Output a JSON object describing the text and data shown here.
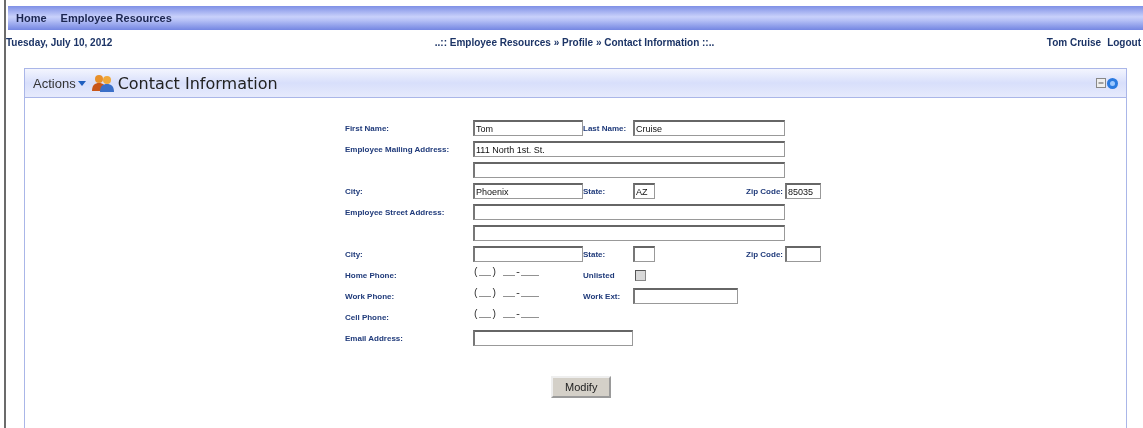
{
  "menu": [
    {
      "label": "Home"
    },
    {
      "label": "Employee Resources"
    }
  ],
  "info_bar": {
    "date": "Tuesday, July 10, 2012",
    "breadcrumb": "..:: Employee Resources » Profile » Contact Information ::..",
    "user": "Tom Cruise",
    "logout": "Logout"
  },
  "panel": {
    "actions": "Actions",
    "title": "Contact Information"
  },
  "form_rows": [
    [
      {
        "kind": "label",
        "text": "First Name:"
      },
      {
        "kind": "input",
        "value": "Tom"
      },
      {
        "kind": "label",
        "text": "Last Name:"
      },
      {
        "kind": "input",
        "value": "Cruise"
      }
    ],
    [
      {
        "kind": "label",
        "text": "Employee Mailing Address:"
      },
      {
        "kind": "input",
        "value": "111 North 1st. St."
      }
    ],
    [
      {
        "kind": "input"
      }
    ],
    [
      {
        "kind": "label",
        "text": "City:"
      },
      {
        "kind": "input",
        "value": "Phoenix"
      },
      {
        "kind": "label",
        "text": "State:"
      },
      {
        "kind": "input",
        "value": "AZ"
      },
      {
        "kind": "label",
        "text": "Zip Code:"
      },
      {
        "kind": "input",
        "value": "85035"
      }
    ],
    [
      {
        "kind": "label",
        "text": "Employee Street Address:"
      },
      {
        "kind": "input"
      }
    ],
    [
      {
        "kind": "input"
      }
    ],
    [
      {
        "kind": "label",
        "text": "City:"
      },
      {
        "kind": "input"
      },
      {
        "kind": "label",
        "text": "State:"
      },
      {
        "kind": "input"
      },
      {
        "kind": "label",
        "text": "Zip Code:"
      },
      {
        "kind": "input"
      }
    ],
    [
      {
        "kind": "label",
        "text": "Home Phone:"
      },
      {
        "kind": "phone",
        "value": "(__) __-___"
      },
      {
        "kind": "label",
        "text": "Unlisted"
      },
      {
        "kind": "checkbox",
        "checked": false,
        "disabled": true
      }
    ],
    [
      {
        "kind": "label",
        "text": "Work Phone:"
      },
      {
        "kind": "phone",
        "value": "(__) __-___"
      },
      {
        "kind": "label",
        "text": "Work Ext:"
      },
      {
        "kind": "input"
      }
    ],
    [
      {
        "kind": "label",
        "text": "Cell Phone:"
      },
      {
        "kind": "phone",
        "value": "(__) __-___"
      }
    ],
    [
      {
        "kind": "label",
        "text": "Email Address:"
      },
      {
        "kind": "input"
      }
    ]
  ],
  "button": "Modify"
}
